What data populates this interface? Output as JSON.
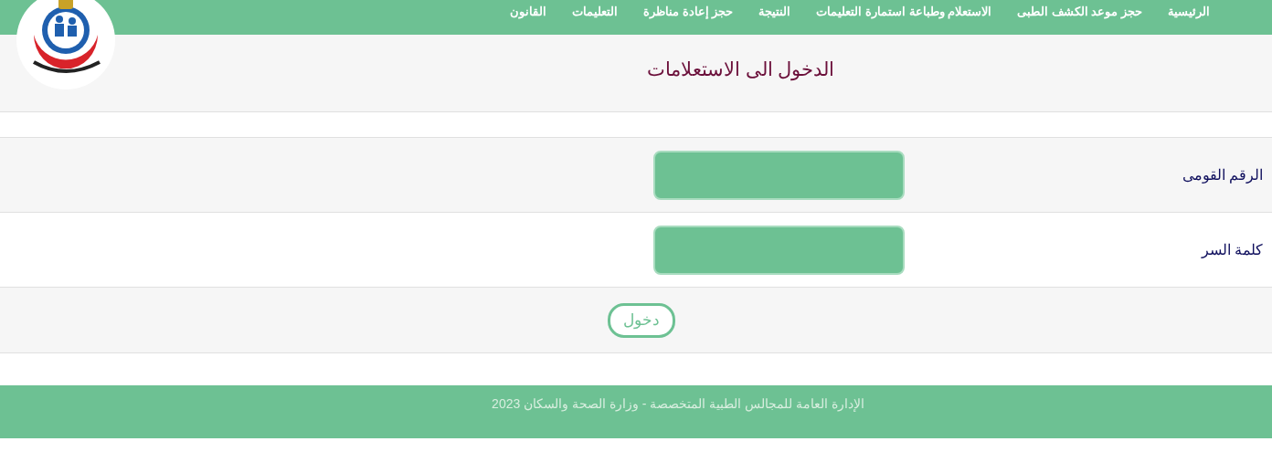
{
  "nav": {
    "items": [
      {
        "label": "الرئيسية"
      },
      {
        "label": "حجز موعد الكشف الطبى"
      },
      {
        "label": "الاستعلام وطباعة استمارة التعليمات"
      },
      {
        "label": "النتيجة"
      },
      {
        "label": "حجز إعادة مناظرة"
      },
      {
        "label": "التعليمات"
      },
      {
        "label": "القانون"
      }
    ]
  },
  "title": "الدخول الى الاستعلامات",
  "form": {
    "fields": [
      {
        "label": "الرقم القومى"
      },
      {
        "label": "كلمة السر"
      }
    ],
    "submit": "دخول"
  },
  "footer": "الإدارة العامة للمجالس الطبية المتخصصة - وزارة الصحة والسكان 2023"
}
